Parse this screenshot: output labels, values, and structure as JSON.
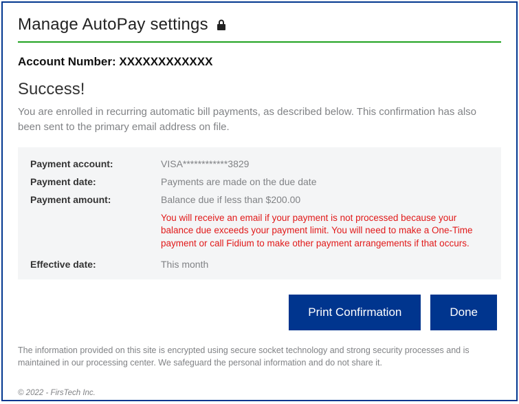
{
  "header": {
    "title": "Manage AutoPay settings"
  },
  "account": {
    "label": "Account Number:",
    "value": "XXXXXXXXXXXX"
  },
  "success": {
    "heading": "Success!",
    "description": "You are enrolled in recurring automatic bill payments, as described below. This confirmation has also been sent to the primary email address on file."
  },
  "details": {
    "payment_account": {
      "label": "Payment account:",
      "value": "VISA************3829"
    },
    "payment_date": {
      "label": "Payment date:",
      "value": "Payments are made on the due date"
    },
    "payment_amount": {
      "label": "Payment amount:",
      "value": "Balance due if less than $200.00"
    },
    "warning": "You will receive an email if your payment is not processed because your balance due exceeds your payment limit. You will need to make a One-Time payment or call Fidium to make other payment arrangements if that occurs.",
    "effective_date": {
      "label": "Effective date:",
      "value": "This month"
    }
  },
  "buttons": {
    "print": "Print Confirmation",
    "done": "Done"
  },
  "disclaimer": "The information provided on this site is encrypted using secure socket technology and strong security processes and is maintained in our processing center. We safeguard the personal information and do not share it.",
  "copyright": "© 2022 - FirsTech Inc."
}
